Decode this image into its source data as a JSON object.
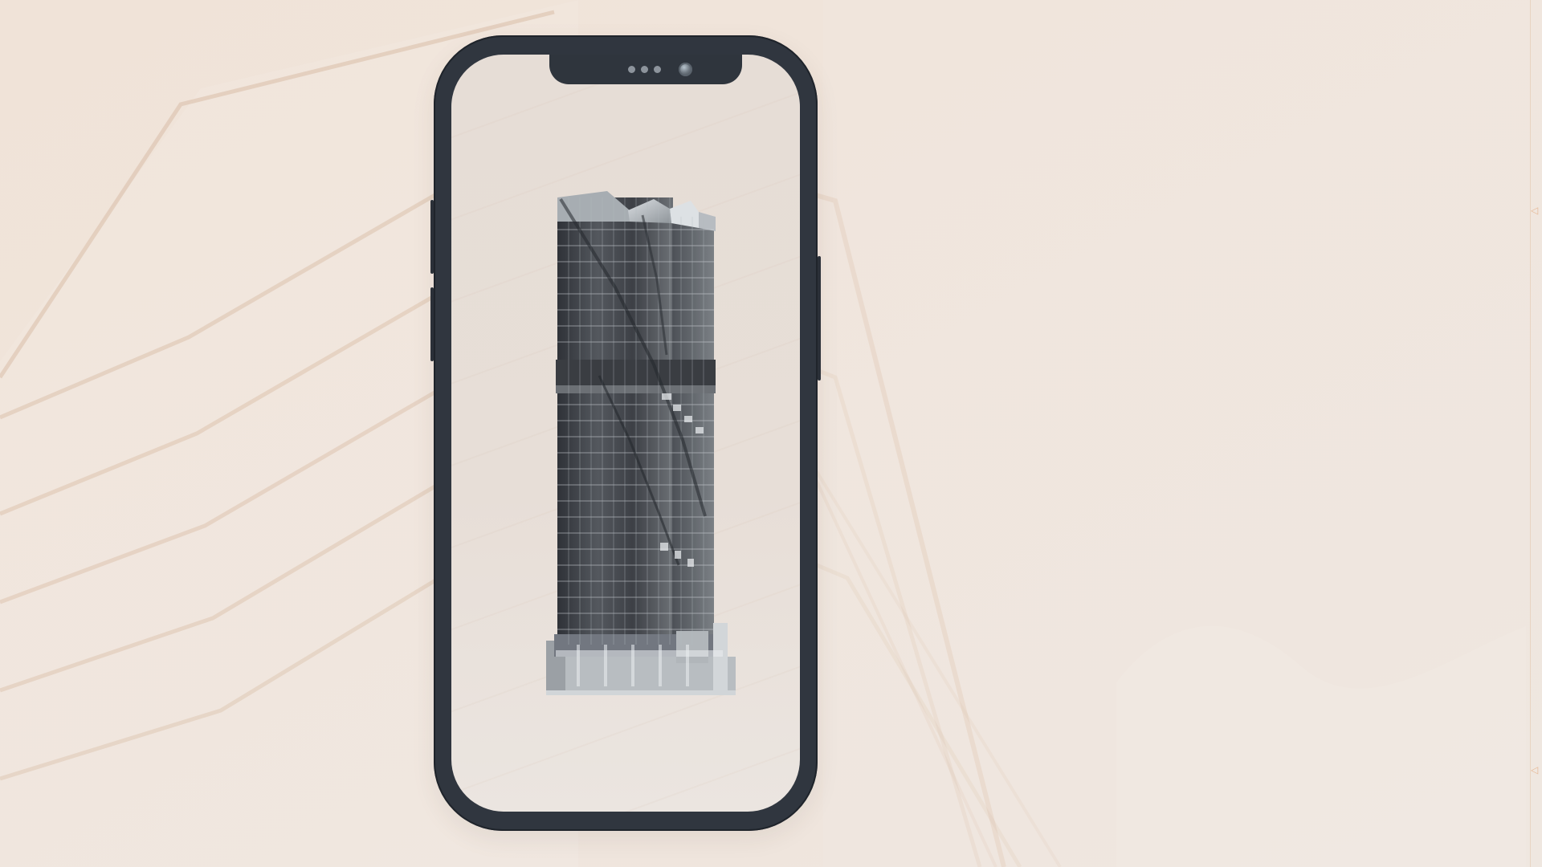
{
  "background": {
    "primary_color": "#efe4da",
    "line_color": "#d8b89a",
    "rail_color": "#e6b996"
  },
  "phone": {
    "frame_color": "#30363f",
    "screen_color": "#e6ddd6"
  },
  "model": {
    "name": "building-model",
    "glass_color": "#4b4f56",
    "frame_color": "#9ea3a8"
  },
  "icons": {
    "rail_marker": "triangle-marker-icon"
  }
}
